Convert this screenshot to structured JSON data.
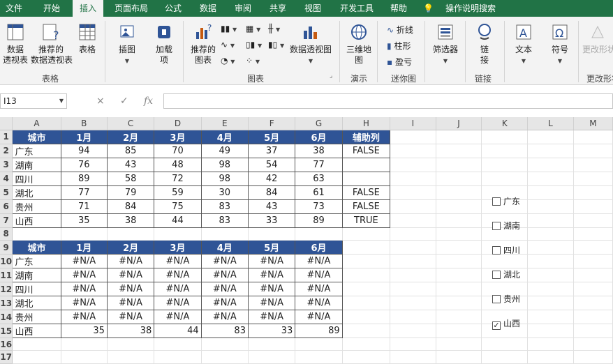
{
  "tabs": [
    "文件",
    "开始",
    "插入",
    "页面布局",
    "公式",
    "数据",
    "审阅",
    "共享",
    "视图",
    "开发工具",
    "帮助",
    "操作说明搜索"
  ],
  "ribbon": {
    "pivot": "数据\n透视表",
    "rec_pivot": "推荐的\n数据透视表",
    "table": "表格",
    "group_tables": "表格",
    "illustrations": "插图",
    "addins": "加载\n项",
    "rec_charts": "推荐的\n图表",
    "pivot_chart": "数据透视图",
    "group_charts": "图表",
    "map3d": "三维地\n图",
    "group_tours": "演示",
    "spark_line": "折线",
    "spark_col": "柱形",
    "spark_wl": "盈亏",
    "group_spark": "迷你图",
    "slicer": "筛选器",
    "link": "链\n接",
    "group_link": "链接",
    "text": "文本",
    "symbol": "符号",
    "change_shape": "更改形状",
    "group_change": "更改形状"
  },
  "namebox": "I13",
  "formula_icons": {
    "cancel": "×",
    "enter": "✓",
    "fx": "fx"
  },
  "col_headers": [
    "A",
    "B",
    "C",
    "D",
    "E",
    "F",
    "G",
    "H",
    "I",
    "J",
    "K",
    "L",
    "M"
  ],
  "row_headers": [
    "1",
    "2",
    "3",
    "4",
    "5",
    "6",
    "7",
    "8",
    "9",
    "10",
    "11",
    "12",
    "13",
    "14",
    "15",
    "16",
    "17"
  ],
  "table1": {
    "header": [
      "城市",
      "1月",
      "2月",
      "3月",
      "4月",
      "5月",
      "6月",
      "辅助列"
    ],
    "rows": [
      [
        "广东",
        "94",
        "85",
        "70",
        "49",
        "37",
        "38",
        "FALSE"
      ],
      [
        "湖南",
        "76",
        "43",
        "48",
        "98",
        "54",
        "77",
        ""
      ],
      [
        "四川",
        "89",
        "58",
        "72",
        "98",
        "42",
        "63",
        ""
      ],
      [
        "湖北",
        "77",
        "79",
        "59",
        "30",
        "84",
        "61",
        "FALSE"
      ],
      [
        "贵州",
        "71",
        "84",
        "75",
        "83",
        "43",
        "73",
        "FALSE"
      ],
      [
        "山西",
        "35",
        "38",
        "44",
        "83",
        "33",
        "89",
        "TRUE"
      ]
    ]
  },
  "table2": {
    "header": [
      "城市",
      "1月",
      "2月",
      "3月",
      "4月",
      "5月",
      "6月"
    ],
    "rows": [
      [
        "广东",
        "#N/A",
        "#N/A",
        "#N/A",
        "#N/A",
        "#N/A",
        "#N/A"
      ],
      [
        "湖南",
        "#N/A",
        "#N/A",
        "#N/A",
        "#N/A",
        "#N/A",
        "#N/A"
      ],
      [
        "四川",
        "#N/A",
        "#N/A",
        "#N/A",
        "#N/A",
        "#N/A",
        "#N/A"
      ],
      [
        "湖北",
        "#N/A",
        "#N/A",
        "#N/A",
        "#N/A",
        "#N/A",
        "#N/A"
      ],
      [
        "贵州",
        "#N/A",
        "#N/A",
        "#N/A",
        "#N/A",
        "#N/A",
        "#N/A"
      ],
      [
        "山西",
        "35",
        "38",
        "44",
        "83",
        "33",
        "89"
      ]
    ]
  },
  "checkboxes": [
    {
      "label": "广东",
      "checked": false
    },
    {
      "label": "湖南",
      "checked": false
    },
    {
      "label": "四川",
      "checked": false
    },
    {
      "label": "湖北",
      "checked": false
    },
    {
      "label": "贵州",
      "checked": false
    },
    {
      "label": "山西",
      "checked": true
    }
  ],
  "colors": {
    "ribbon_green": "#217346",
    "header_blue": "#2f5496"
  }
}
